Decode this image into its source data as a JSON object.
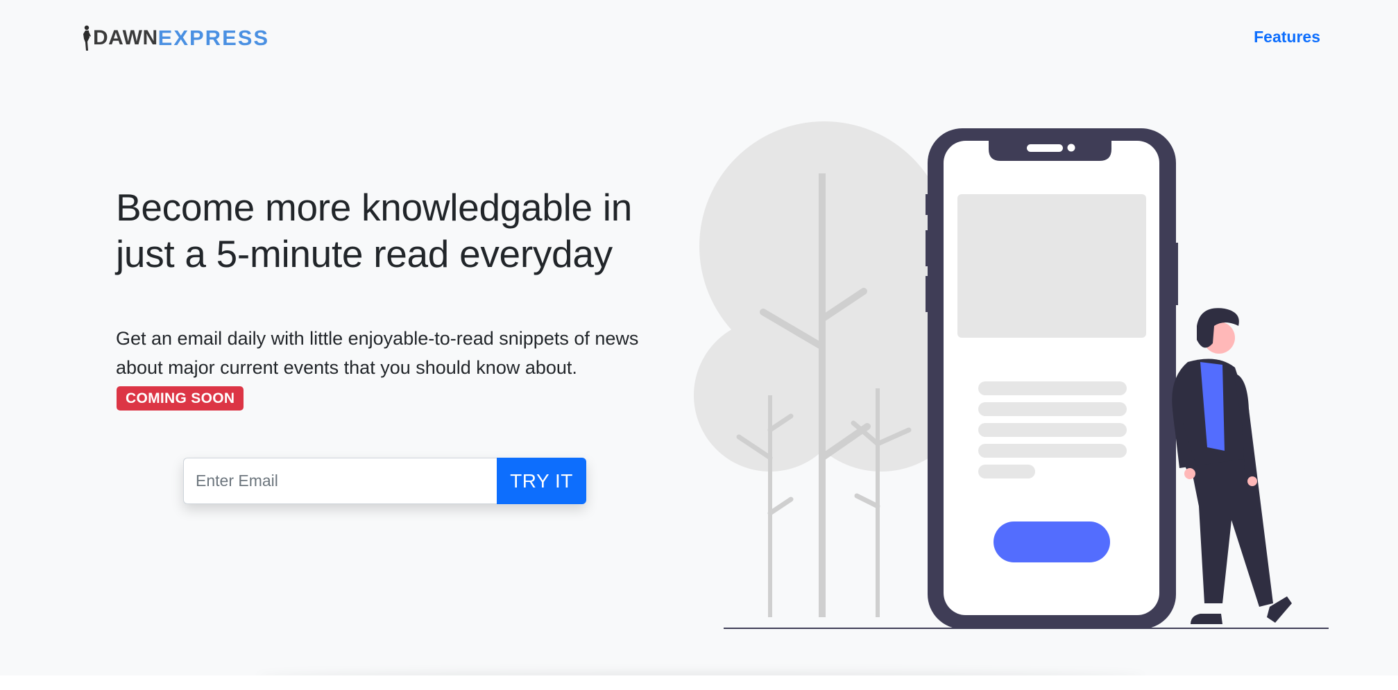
{
  "brand": {
    "part1": "DAWN",
    "part2": "EXPRESS"
  },
  "nav": {
    "features": "Features"
  },
  "hero": {
    "title": "Become more knowledgable in just a 5-minute read everyday",
    "description": "Get an email daily with little enjoyable-to-read snippets of news about major current events that you should know about.",
    "badge": "COMING SOON"
  },
  "signup": {
    "placeholder": "Enter Email",
    "button": "TRY IT"
  },
  "colors": {
    "accent": "#0d6efd",
    "badge": "#dc3545",
    "brand_blue": "#4a90e2",
    "phone": "#3f3d56",
    "illustration_button": "#536dfe"
  },
  "icons": {
    "logo": "runner-silhouette-icon"
  }
}
